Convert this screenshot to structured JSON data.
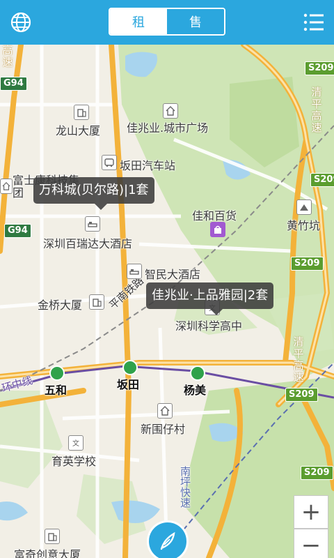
{
  "header": {
    "tabs": [
      {
        "label": "租",
        "active": true
      },
      {
        "label": "售",
        "active": false
      }
    ],
    "accent_color": "#2ba7de"
  },
  "map": {
    "places": {
      "longshan": "龙山大厦",
      "jiazhao_plaza": "佳兆业.城市广场",
      "bantian_bus": "坂田汽车站",
      "foxconn": "富士康科技集团",
      "vanke_hidden": "",
      "jiahe": "佳和百货",
      "huangzhukeng": "黄竹坑",
      "bairuida": "深圳百瑞达大酒店",
      "zhimin": "智民大酒店",
      "jinqiao": "金桥大厦",
      "science_high": "深圳科学高中",
      "xinweizai": "新围仔村",
      "yuying": "育英学校",
      "fuqi": "富奇创意大厦"
    },
    "roads": {
      "gaosu_left": "高速",
      "g94": "G94",
      "g94_2": "G94",
      "s209_a": "S209",
      "s209_b": "S209",
      "s209_c": "S209",
      "s209_d": "S209",
      "s209_e": "S209",
      "qingping_1": "清平高速",
      "qingping_2": "清平高速",
      "pingnan": "平南铁路",
      "nanping": "南坪快速",
      "huanzhong": "环中线"
    },
    "stations": {
      "wuhe": "五和",
      "bantian": "坂田",
      "yangmei": "杨美"
    },
    "callouts": {
      "vanke": "万科城(贝尔路)|1套",
      "jiazhao_shangpin": "佳兆业·上品雅园|2套"
    },
    "controls": {
      "zoom_in": "+",
      "zoom_out": "−"
    }
  }
}
